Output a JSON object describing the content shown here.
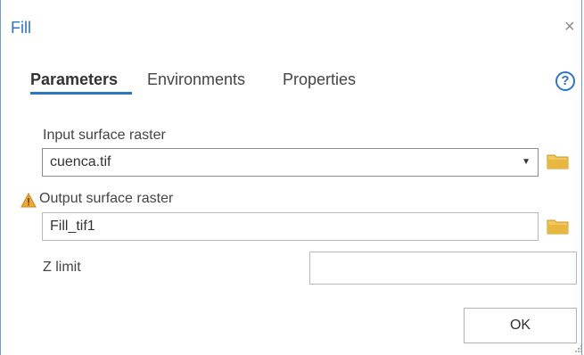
{
  "dialog": {
    "title": "Fill",
    "close_symbol": "×"
  },
  "tabs": [
    {
      "label": "Parameters",
      "active": true
    },
    {
      "label": "Environments",
      "active": false
    },
    {
      "label": "Properties",
      "active": false
    }
  ],
  "help_symbol": "?",
  "parameters": {
    "input_label": "Input surface raster",
    "input_value": "cuenca.tif",
    "output_label": "Output surface raster",
    "output_value": "Fill_tif1",
    "zlimit_label": "Z limit",
    "zlimit_value": ""
  },
  "buttons": {
    "ok_label": "OK"
  },
  "icons": {
    "close": "close-icon",
    "help": "help-icon",
    "folder": "folder-icon",
    "warning": "warning-icon",
    "dropdown": "chevron-down-icon",
    "grip": "resize-grip-icon"
  },
  "colors": {
    "accent": "#2e75c9",
    "folder": "#e8b73f",
    "warning": "#f0a830"
  }
}
